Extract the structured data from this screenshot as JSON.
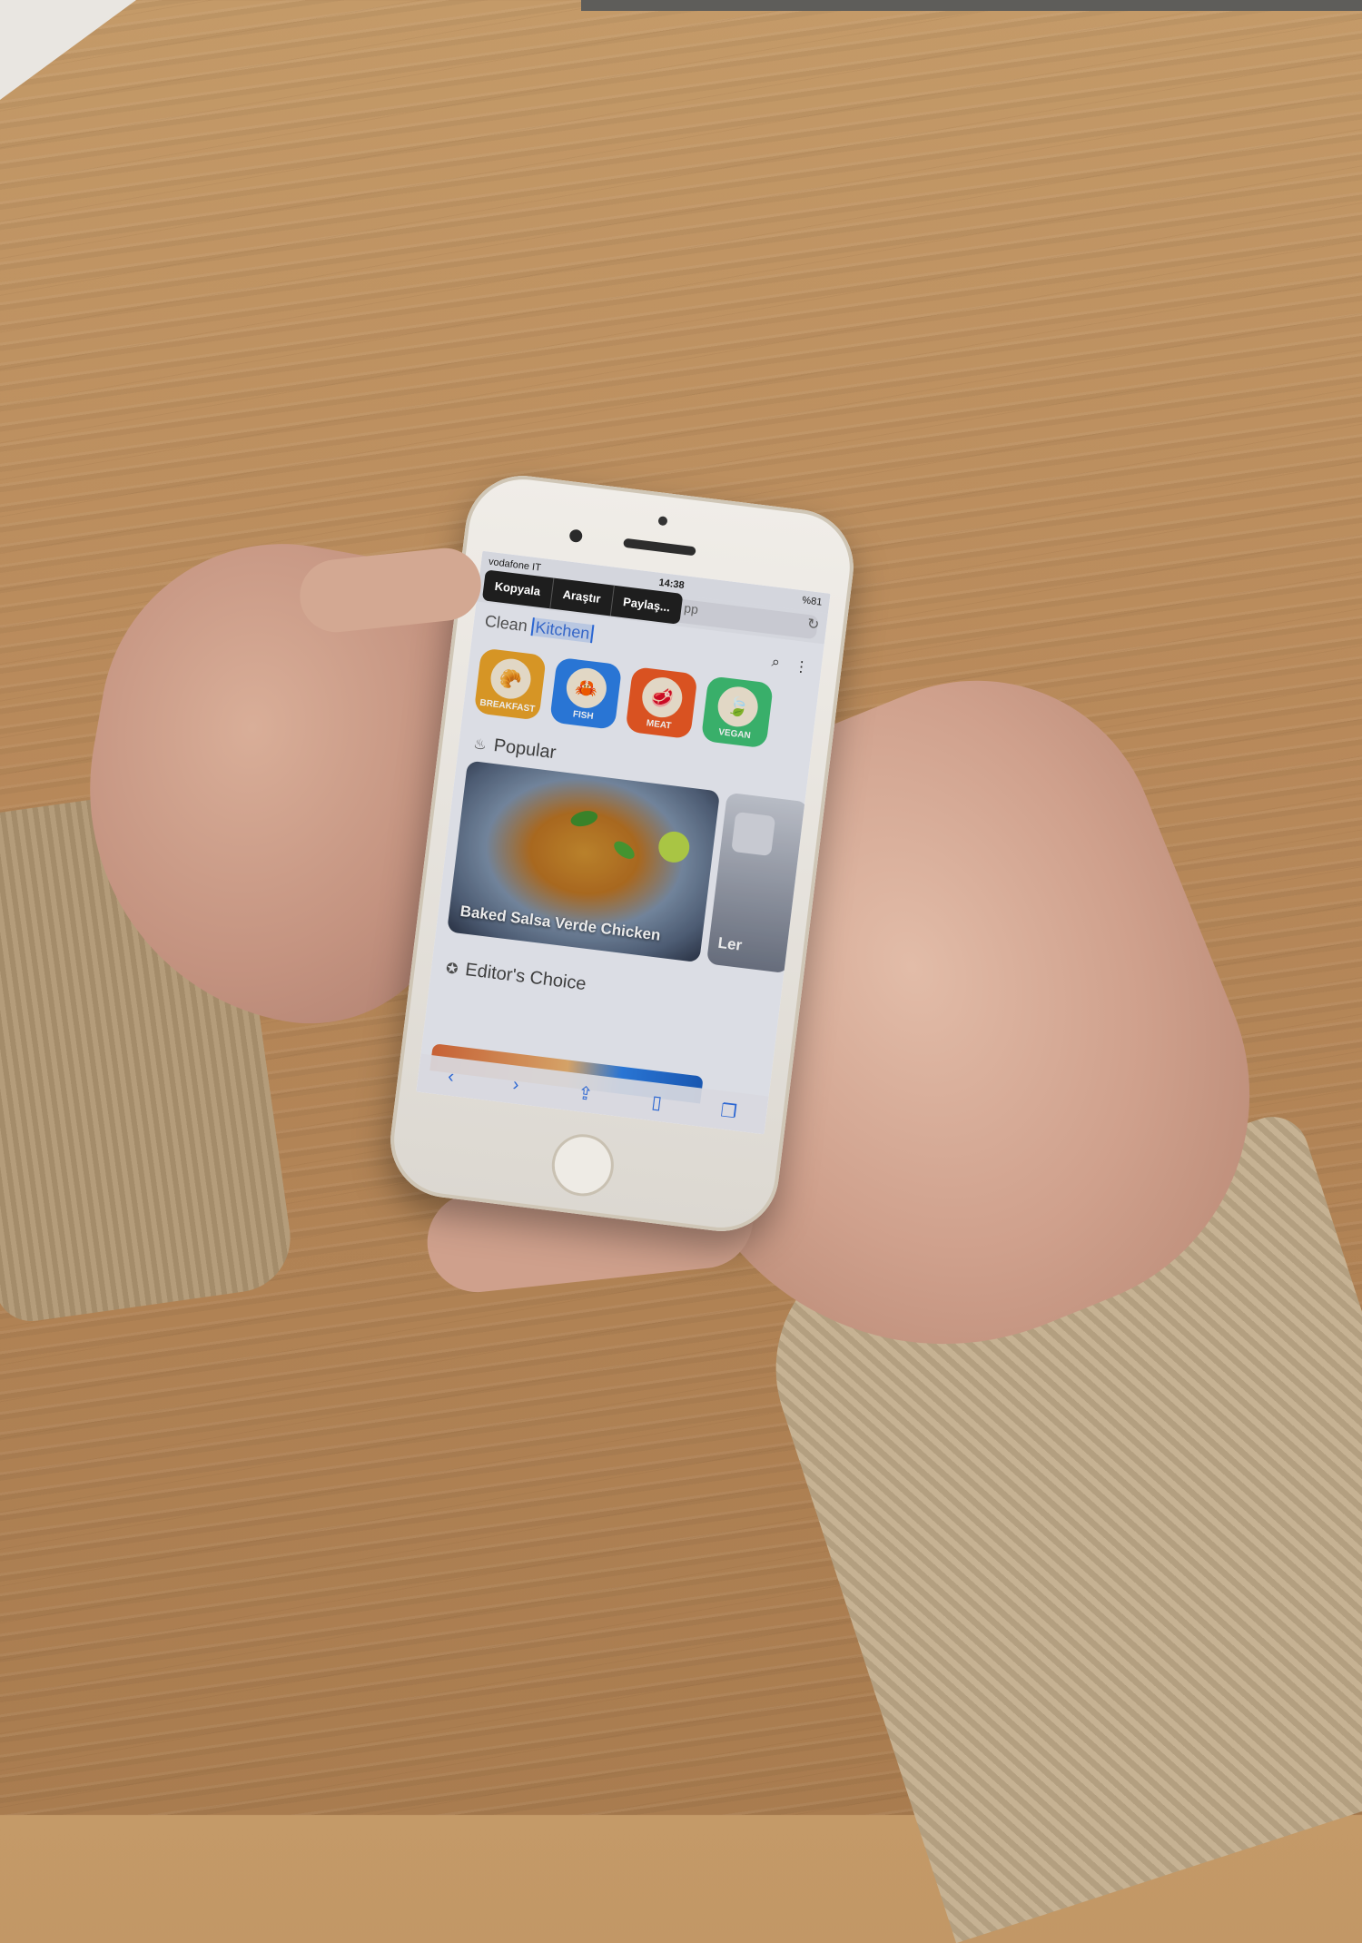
{
  "status_bar": {
    "carrier": "vodafone IT",
    "time": "14:38",
    "battery": "%81"
  },
  "browser": {
    "url_fragment": "pp",
    "context_menu": [
      "Kopyala",
      "Araştır",
      "Paylaş..."
    ]
  },
  "app": {
    "brand_prefix": "Clean",
    "brand_selected": "Kitchen",
    "categories": [
      {
        "label": "BREAKFAST",
        "icon": "croissant-icon",
        "color": "#e9a229"
      },
      {
        "label": "FISH",
        "icon": "crab-icon",
        "color": "#2d7fe6"
      },
      {
        "label": "MEAT",
        "icon": "meat-icon",
        "color": "#ec5a24"
      },
      {
        "label": "VEGAN",
        "icon": "leaf-icon",
        "color": "#3ebe74"
      }
    ],
    "popular": {
      "title": "Popular",
      "cards": [
        {
          "title": "Baked Salsa Verde Chicken"
        },
        {
          "title": "Ler"
        }
      ]
    },
    "editors_choice": {
      "title": "Editor's Choice"
    }
  },
  "colors": {
    "ios_blue": "#2f6fe4",
    "table_wood": "#c49a68"
  }
}
